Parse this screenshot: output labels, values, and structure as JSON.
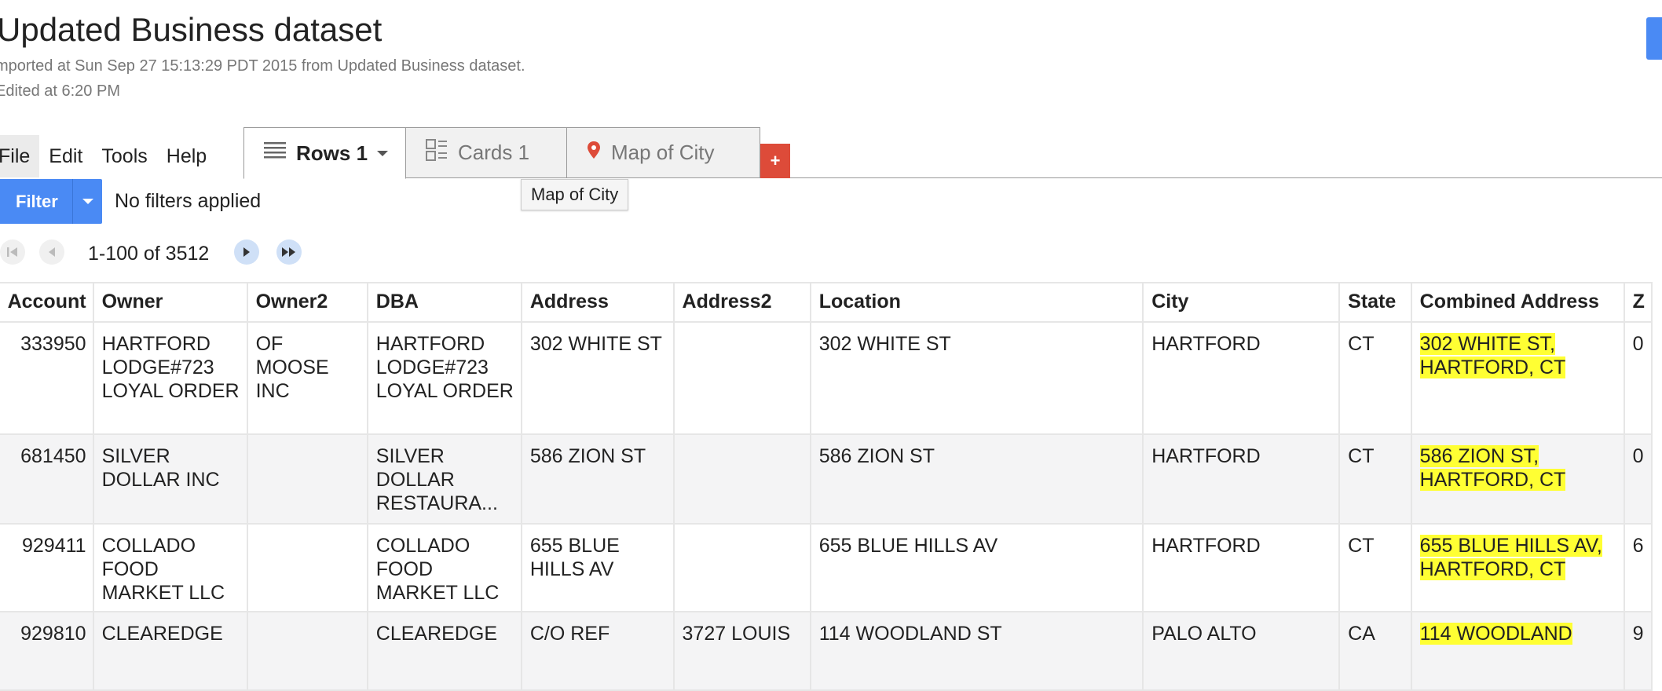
{
  "header": {
    "title": "Updated Business dataset",
    "imported": "mported at Sun Sep 27 15:13:29 PDT 2015 from Updated Business dataset.",
    "edited": "Edited at 6:20 PM"
  },
  "menu": [
    "File",
    "Edit",
    "Tools",
    "Help"
  ],
  "tabs": {
    "rows": "Rows 1",
    "cards": "Cards 1",
    "map": "Map of City",
    "add": "+"
  },
  "tooltip": "Map of City",
  "filter": {
    "button_label": "Filter",
    "status": "No filters applied"
  },
  "pager": {
    "range": "1-100 of 3512"
  },
  "table": {
    "columns": [
      "Account",
      "Owner",
      "Owner2",
      "DBA",
      "Address",
      "Address2",
      "Location",
      "City",
      "State",
      "Combined Address",
      "Z"
    ],
    "rows": [
      {
        "account": "333950",
        "owner": "HARTFORD LODGE#723 LOYAL ORDER",
        "owner2": "OF MOOSE INC",
        "dba": "HARTFORD LODGE#723 LOYAL ORDER",
        "address": "302 WHITE ST",
        "address2": "",
        "location": "302 WHITE ST",
        "city": "HARTFORD",
        "state": "CT",
        "combined": "302 WHITE ST, HARTFORD, CT",
        "zip": "0"
      },
      {
        "account": "681450",
        "owner": "SILVER DOLLAR INC",
        "owner2": "",
        "dba": "SILVER DOLLAR RESTAURA...",
        "address": "586 ZION ST",
        "address2": "",
        "location": "586 ZION ST",
        "city": "HARTFORD",
        "state": "CT",
        "combined": "586 ZION ST, HARTFORD, CT",
        "zip": "0"
      },
      {
        "account": "929411",
        "owner": "COLLADO FOOD MARKET LLC",
        "owner2": "",
        "dba": "COLLADO FOOD MARKET LLC",
        "address": "655 BLUE HILLS AV",
        "address2": "",
        "location": "655 BLUE HILLS AV",
        "city": "HARTFORD",
        "state": "CT",
        "combined": "655 BLUE HILLS AV, HARTFORD, CT",
        "zip": "6"
      },
      {
        "account": "929810",
        "owner": "CLEAREDGE",
        "owner2": "",
        "dba": "CLEAREDGE",
        "address": "C/O REF",
        "address2": "3727 LOUIS",
        "location": "114 WOODLAND ST",
        "city": "PALO ALTO",
        "state": "CA",
        "combined": "114 WOODLAND",
        "zip": "9"
      }
    ]
  },
  "colors": {
    "accent_blue": "#4a8af4",
    "add_tab_red": "#dd4b39",
    "highlight_yellow": "#ffff33"
  }
}
